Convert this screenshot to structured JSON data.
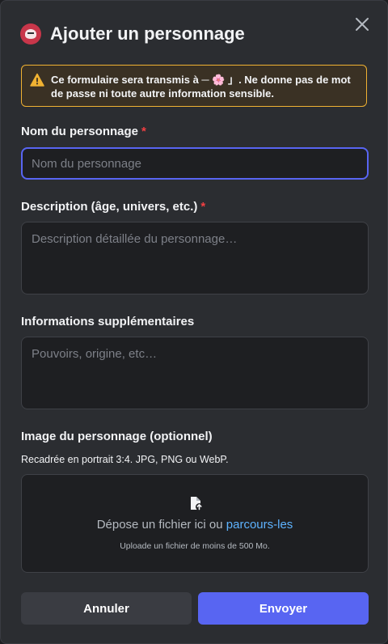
{
  "modal": {
    "title": "Ajouter un personnage",
    "warning": {
      "text_before": "Ce formulaire sera transmis à ",
      "recipient_prefix": "─ ",
      "recipient_flower": "🌸",
      "recipient_suffix": " 」",
      "text_after": ". Ne donne pas de mot de passe ni toute autre information sensible."
    },
    "fields": {
      "name": {
        "label": "Nom du personnage",
        "required_mark": "*",
        "placeholder": "Nom du personnage",
        "value": ""
      },
      "description": {
        "label": "Description (âge, univers, etc.)",
        "required_mark": "*",
        "placeholder": "Description détaillée du personnage…",
        "value": ""
      },
      "extra": {
        "label": "Informations supplémentaires",
        "placeholder": "Pouvoirs, origine, etc…",
        "value": ""
      }
    },
    "image": {
      "label": "Image du personnage (optionnel)",
      "subtext": "Recadrée en portrait 3:4. JPG, PNG ou WebP.",
      "drop_text": "Dépose un fichier ici ou ",
      "browse_link": "parcours-les",
      "hint": "Uploade un fichier de moins de 500 Mo."
    },
    "buttons": {
      "cancel": "Annuler",
      "submit": "Envoyer"
    }
  },
  "colors": {
    "accent": "#5865f2",
    "warning_border": "#f0b232",
    "required": "#f23f42",
    "link": "#5eb3ff"
  },
  "icons": [
    "app-avatar-icon",
    "close-icon",
    "warning-icon",
    "file-upload-icon"
  ]
}
